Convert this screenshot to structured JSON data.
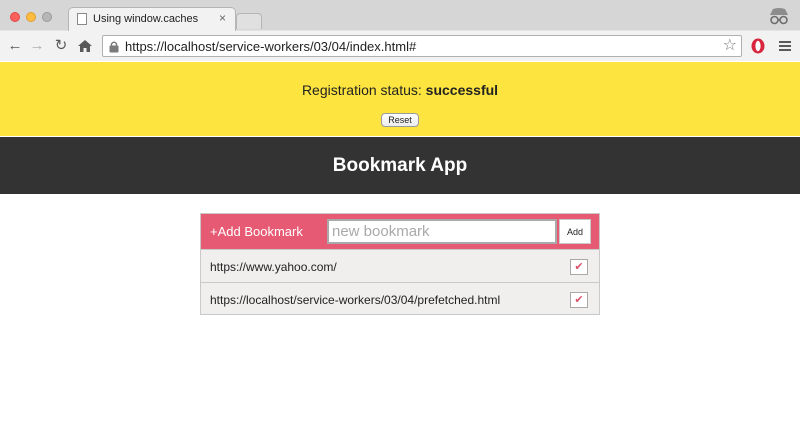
{
  "browser": {
    "tab_title": "Using window.caches",
    "tab_close_glyph": "×",
    "url": "https://localhost/service-workers/03/04/index.html#",
    "icons": [
      "back-icon",
      "forward-icon",
      "reload-icon",
      "home-icon",
      "lock-icon",
      "star-icon",
      "opera-icon",
      "menu-icon",
      "incognito-icon"
    ]
  },
  "status": {
    "label": "Registration status:",
    "value": "successful",
    "reset_label": "Reset"
  },
  "app": {
    "title": "Bookmark App",
    "add_label": "+Add Bookmark",
    "input_placeholder": "new bookmark",
    "input_value": "",
    "add_button_label": "Add",
    "bookmarks": [
      {
        "url": "https://www.yahoo.com/",
        "check": "✔"
      },
      {
        "url": "https://localhost/service-workers/03/04/prefetched.html",
        "check": "✔"
      }
    ]
  },
  "colors": {
    "banner": "#fde43f",
    "header": "#333333",
    "accent": "#e75a73"
  }
}
